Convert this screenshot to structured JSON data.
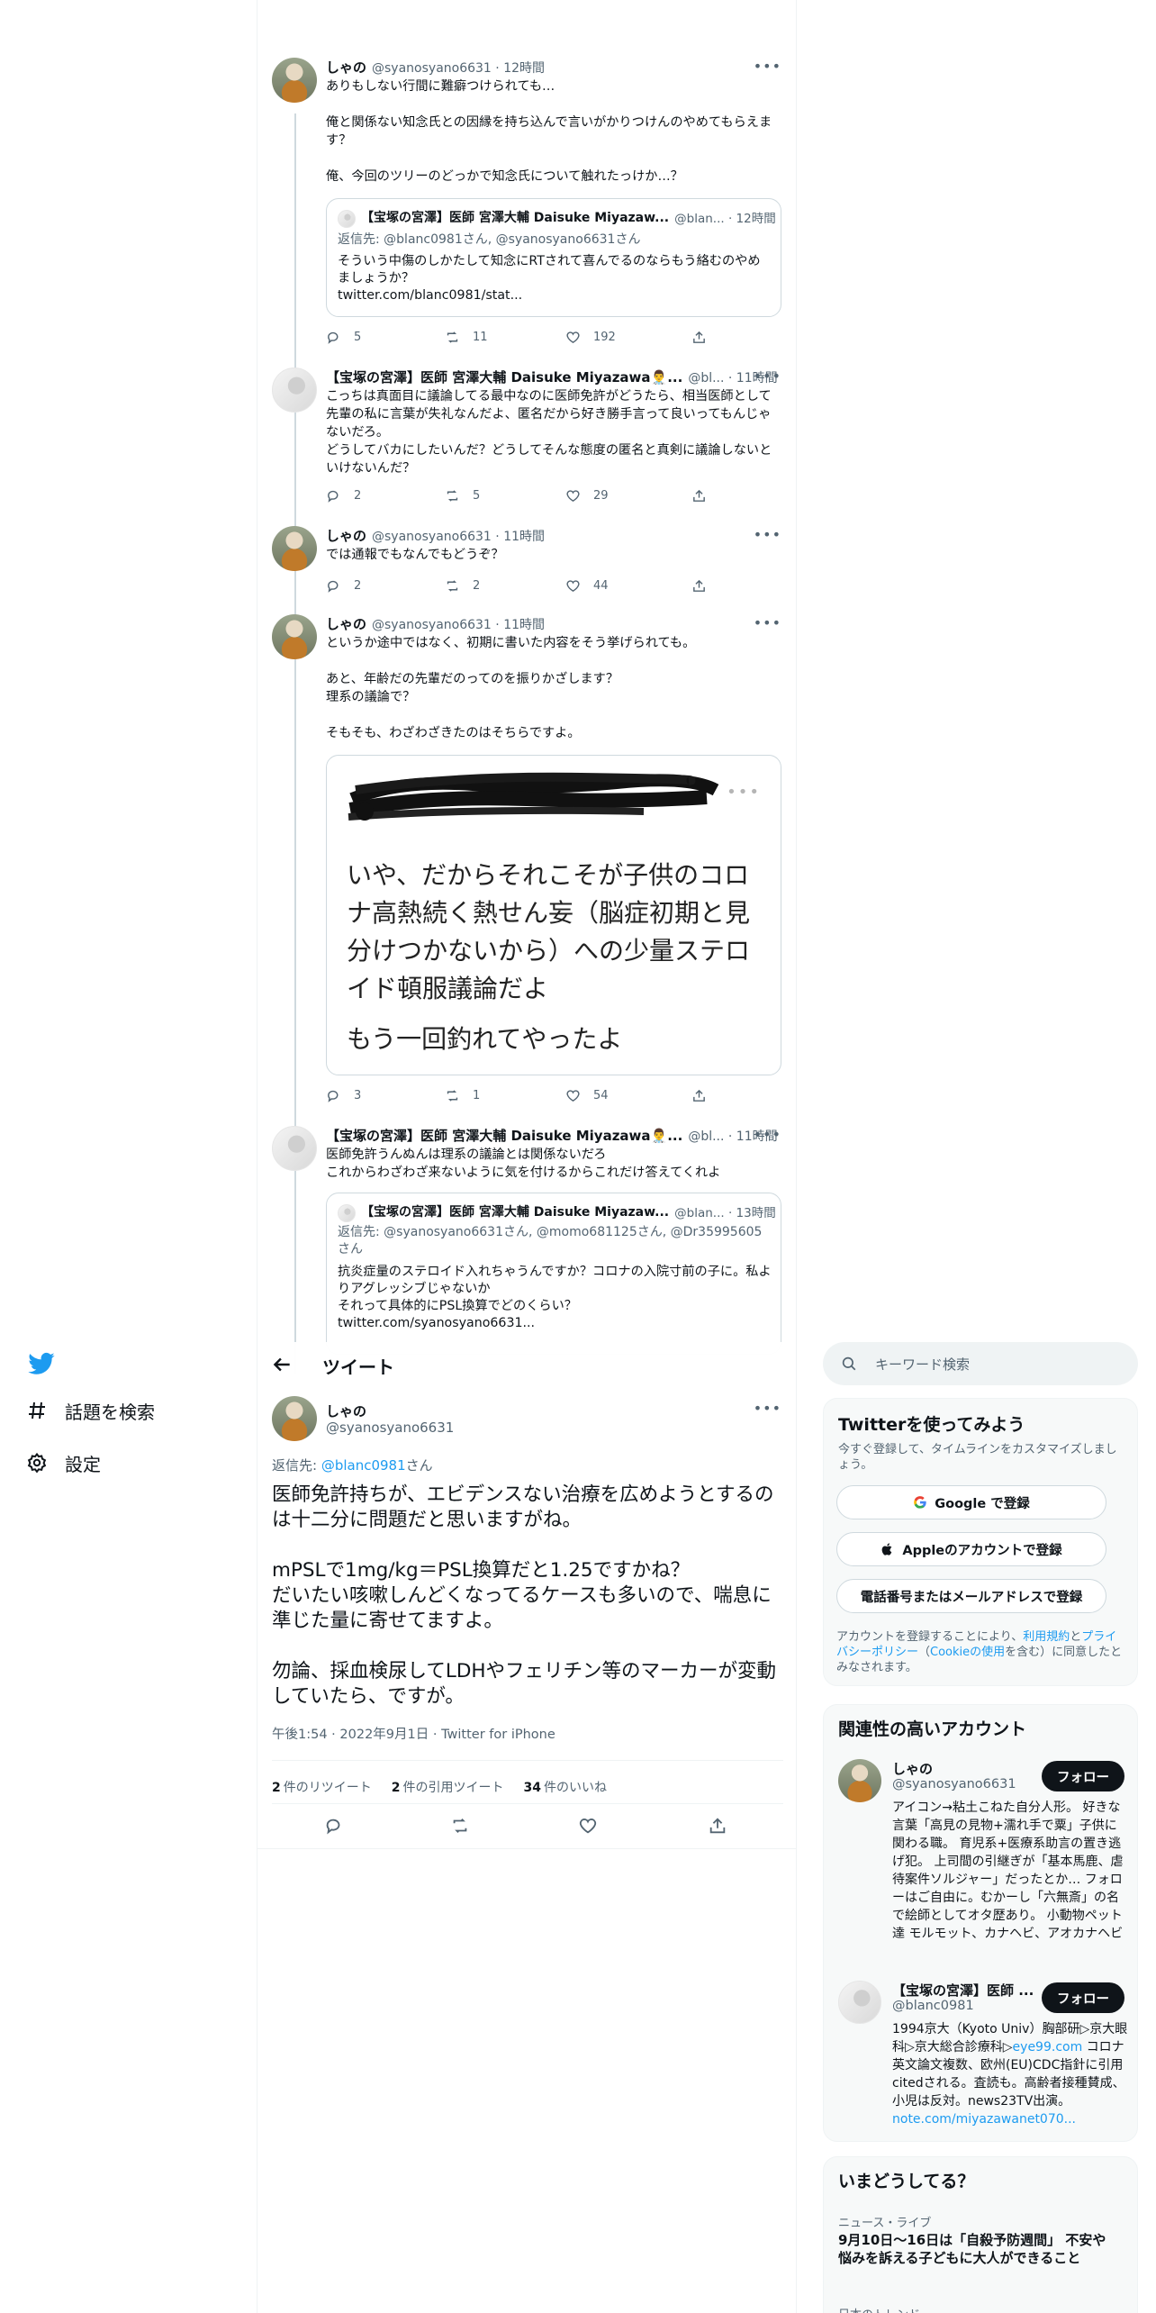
{
  "nav": {
    "explore_label": "話題を検索",
    "settings_label": "設定"
  },
  "header": {
    "title": "ツイート"
  },
  "thread": {
    "t1": {
      "name": "しゃの",
      "handle_time": "@syanosyano6631 · 12時間",
      "body": "ありもしない行間に難癖つけられても…\n\n俺と関係ない知念氏との因縁を持ち込んで言いがかりつけんのやめてもらえます？\n\n俺、今回のツリーのどっかで知念氏について触れたっけか…？",
      "quote": {
        "name": "【宝塚の宮澤】医師 宮澤大輔 Daisuke Miyazaw...",
        "handle_time": "@blan... · 12時間",
        "reply": "返信先: @blanc0981さん, @syanosyano6631さん",
        "body": "そういう中傷のしかたして知念にRTされて喜んでるのならもう絡むのやめましょうか？\ntwitter.com/blanc0981/stat..."
      },
      "replies": "5",
      "retweets": "11",
      "likes": "192"
    },
    "t2": {
      "name": "【宝塚の宮澤】医師 宮澤大輔 Daisuke Miyazawa👨‍⚕️...",
      "handle_time": "@bl... · 11時間",
      "body": "こっちは真面目に議論してる最中なのに医師免許がどうたら、相当医師として先輩の私に言葉が失礼なんだよ、匿名だから好き勝手言って良いってもんじゃないだろ。\nどうしてバカにしたいんだ？どうしてそんな態度の匿名と真剣に議論しないといけないんだ？",
      "replies": "2",
      "retweets": "5",
      "likes": "29"
    },
    "t3": {
      "name": "しゃの",
      "handle_time": "@syanosyano6631 · 11時間",
      "body": "では通報でもなんでもどうぞ？",
      "replies": "2",
      "retweets": "2",
      "likes": "44"
    },
    "t4": {
      "name": "しゃの",
      "handle_time": "@syanosyano6631 · 11時間",
      "body": "というか途中ではなく、初期に書いた内容をそう挙げられても。\n\nあと、年齢だの先輩だのってのを振りかざします？\n理系の議論で？\n\nそもそも、わざわざきたのはそちらですよ。",
      "image_text": "いや、だからそれこそが子供のコロナ高熱続く熱せん妄（脳症初期と見分けつかないから）への少量ステロイド頓服議論だよ",
      "image_text2": "もう一回釣れてやったよ",
      "replies": "3",
      "retweets": "1",
      "likes": "54"
    },
    "t5": {
      "name": "【宝塚の宮澤】医師 宮澤大輔 Daisuke Miyazawa👨‍⚕️...",
      "handle_time": "@bl... · 11時間",
      "body": "医師免許うんぬんは理系の議論とは関係ないだろ\nこれからわざわざ来ないように気を付けるからこれだけ答えてくれよ",
      "quote": {
        "name": "【宝塚の宮澤】医師 宮澤大輔 Daisuke Miyazaw...",
        "handle_time": "@blan... · 13時間",
        "reply": "返信先: @syanosyano6631さん, @momo681125さん, @Dr35995605さん",
        "body": "抗炎症量のステロイド入れちゃうんですか？コロナの入院寸前の子に。私よりアグレッシブじゃないか\nそれって具体的にPSL換算でどのくらい？\ntwitter.com/syanosyano6631..."
      }
    }
  },
  "focused": {
    "name": "しゃの",
    "handle": "@syanosyano6631",
    "reply_prefix": "返信先: ",
    "reply_to": "@blanc0981",
    "reply_suffix": "さん",
    "body": "医師免許持ちが、エビデンスない治療を広めようとするのは十二分に問題だと思いますがね。\n\nmPSLで1mg/kg＝PSL換算だと1.25ですかね？\nだいたい咳嗽しんどくなってるケースも多いので、喘息に準じた量に寄せてますよ。\n\n勿論、採血検尿してLDHやフェリチン等のマーカーが変動していたら、ですが。",
    "meta": "午後1:54 · 2022年9月1日 · Twitter for iPhone",
    "retweets_num": "2",
    "retweets_label": "件のリツイート",
    "quotes_num": "2",
    "quotes_label": "件の引用ツイート",
    "likes_num": "34",
    "likes_label": "件のいいね"
  },
  "sidebar": {
    "search_placeholder": "キーワード検索",
    "signup": {
      "title": "Twitterを使ってみよう",
      "desc": "今すぐ登録して、タイムラインをカスタマイズしましょう。",
      "google": "Google で登録",
      "apple": "Appleのアカウントで登録",
      "phone": "電話番号またはメールアドレスで登録",
      "legal_1": "アカウントを登録することにより、",
      "legal_terms": "利用規約",
      "legal_2": "と",
      "legal_privacy": "プライバシーポリシー",
      "legal_3": "（",
      "legal_cookie": "Cookieの使用",
      "legal_4": "を含む）に同意したとみなされます。"
    },
    "related": {
      "title": "関連性の高いアカウント",
      "follow_label": "フォロー",
      "a1_name": "しゃの",
      "a1_handle": "@syanosyano6631",
      "a1_bio": "アイコン→粘土こねた自分人形。 好きな言葉「高見の見物+濡れ手で粟」子供に関わる職。 育児系+医療系助言の置き逃げ犯。 上司間の引継ぎが「基本馬鹿、虐待案件ソルジャー」だったとか… フォローはご自由に。むかーし「六無斎」の名で絵師としてオタ歴あり。 小動物ペット達 モルモット、カナヘビ、アオカナヘビ",
      "a2_name": "【宝塚の宮澤】医師 ...",
      "a2_handle": "@blanc0981",
      "a2_bio_1": "1994京大（Kyoto Univ）胸部研▷京大眼科▷京大総合診療科▷",
      "a2_bio_link1": "eye99.com",
      "a2_bio_2": " コロナ英文論文複数、欧州(EU)CDC指針に引用citedされる。査読も。高齢者接種賛成、小児は反対。news23TV出演。 ",
      "a2_bio_link2": "note.com/miyazawanet070..."
    },
    "trends": {
      "title": "いまどうしてる？",
      "t1_sub": "ニュース・ライブ",
      "t1_text": "9月10日〜16日は「自殺予防週間」 不安や悩みを訴える子どもに大人ができること",
      "t2_sub": "日本のトレンド"
    }
  }
}
